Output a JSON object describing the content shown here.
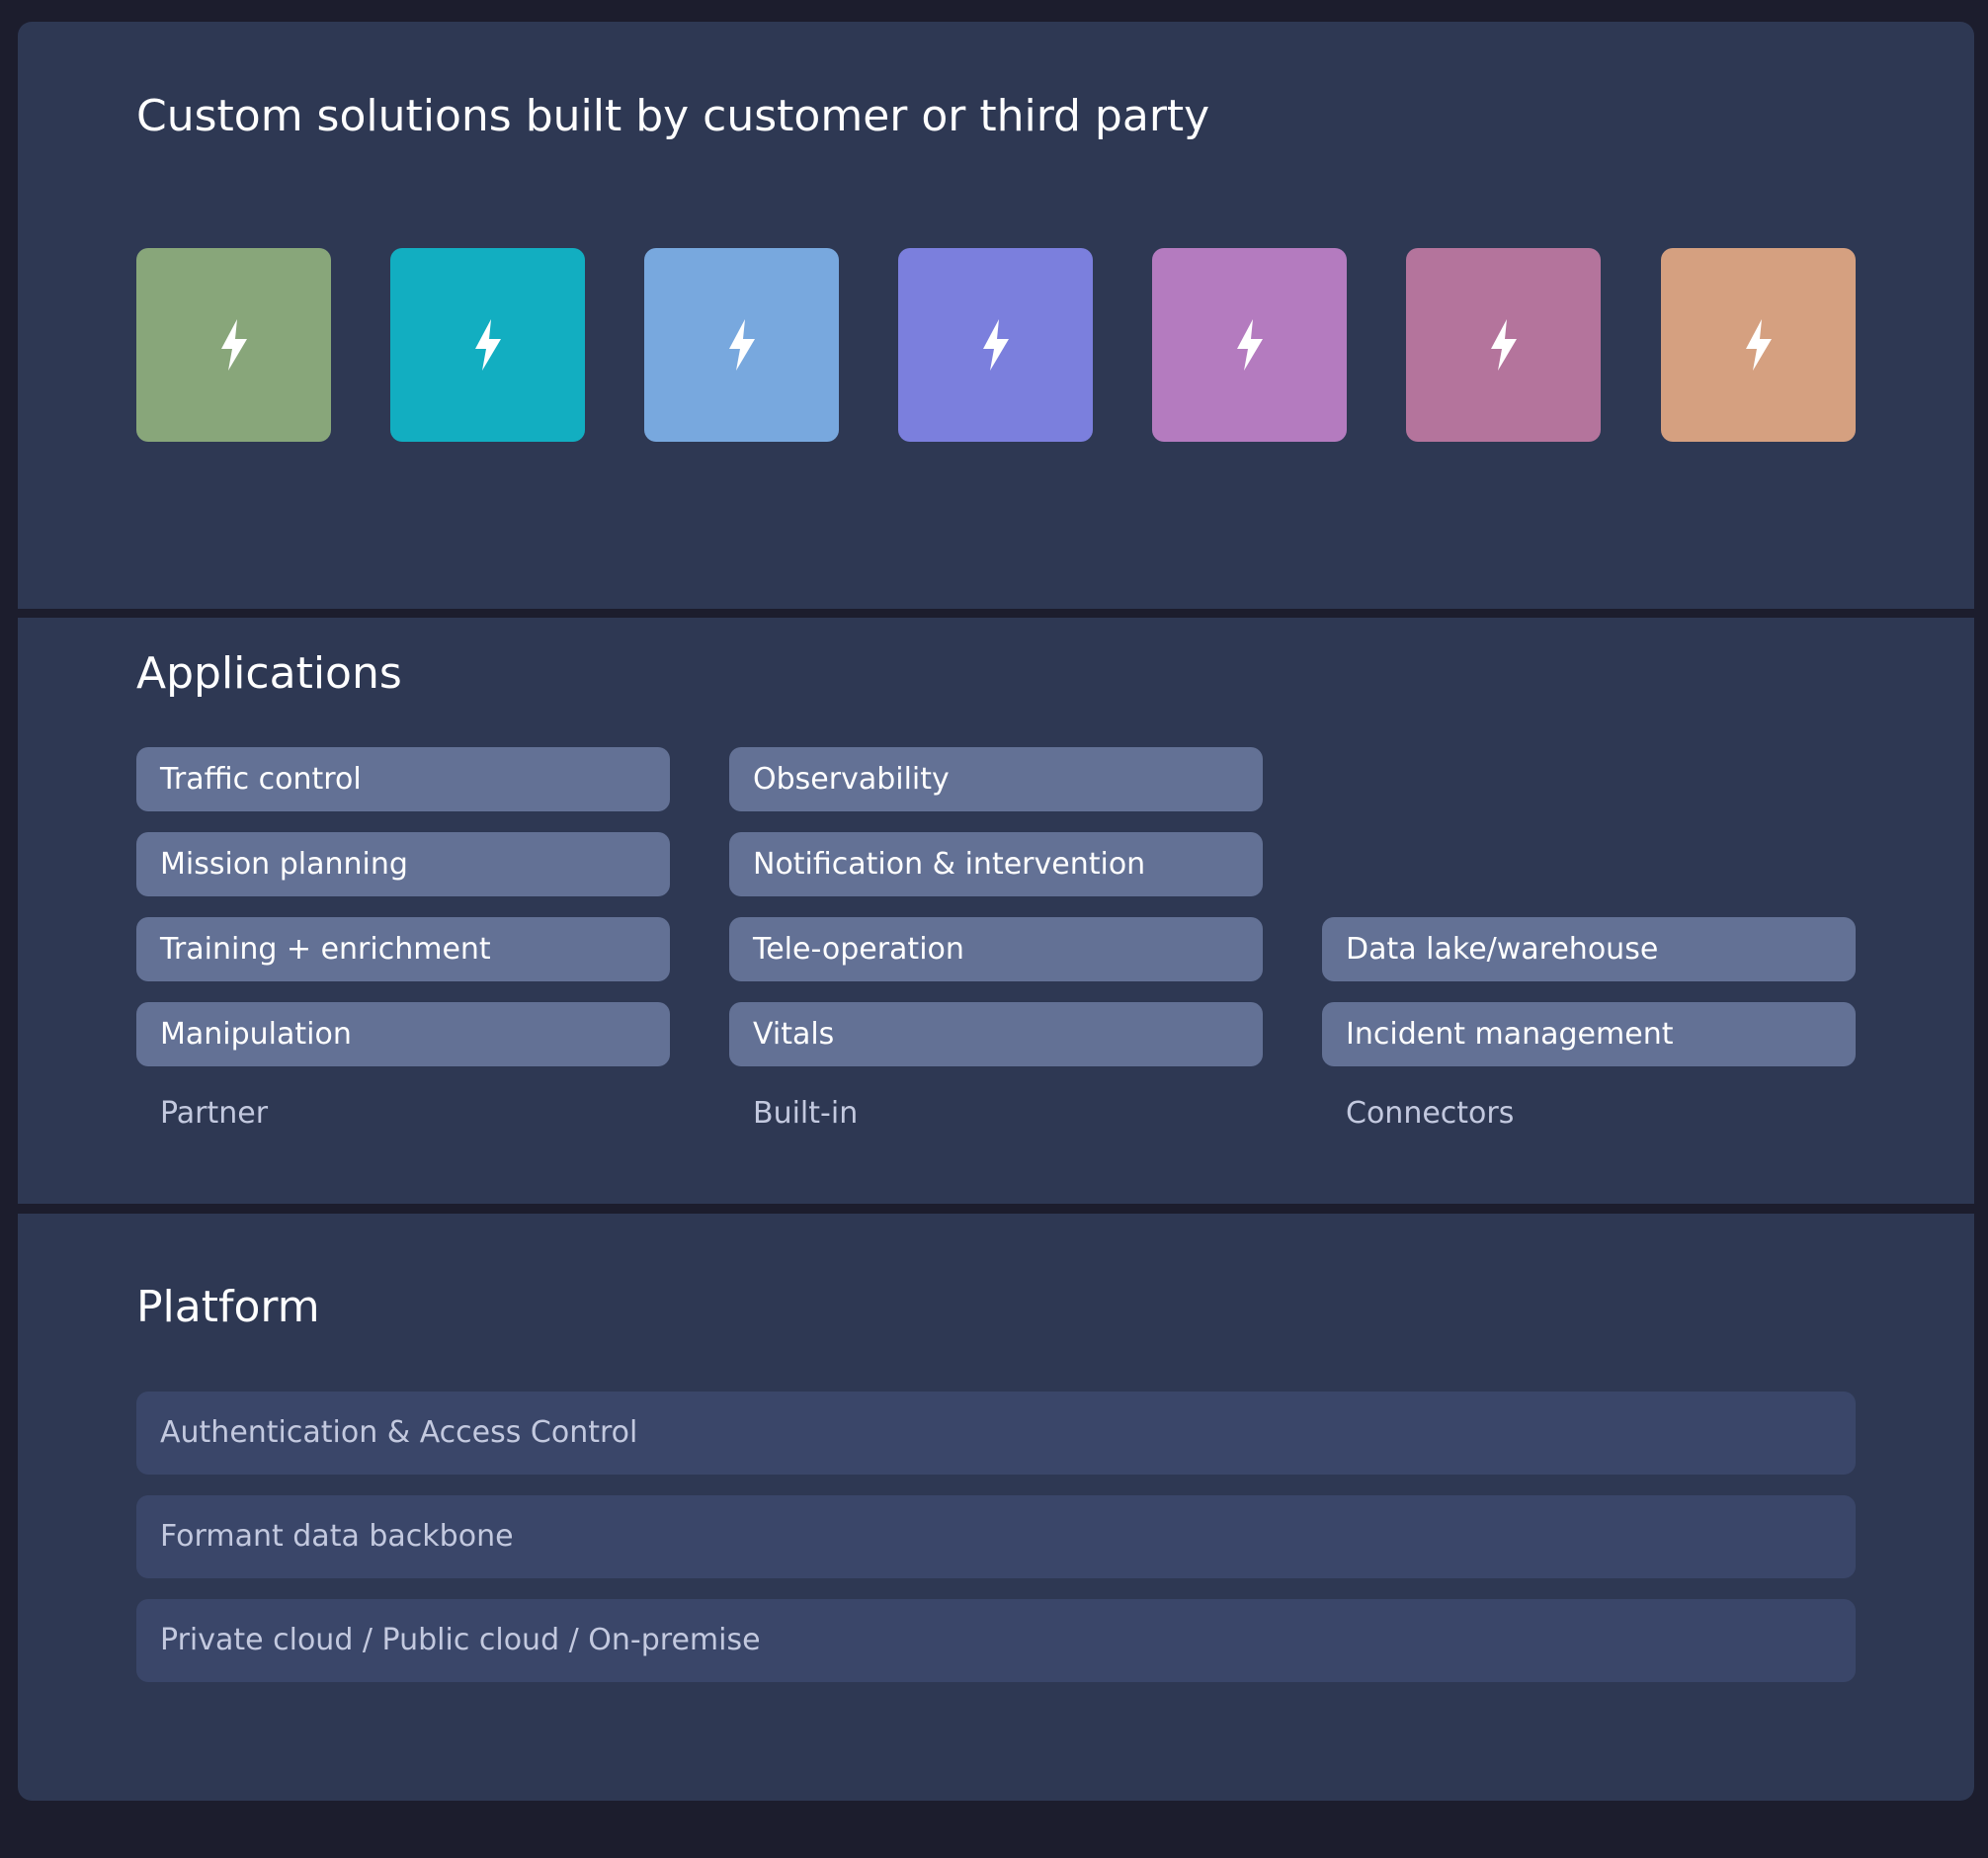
{
  "custom": {
    "title": "Custom solutions built by customer or third party",
    "tiles": [
      {
        "color": "#88a67a",
        "icon": "lightning-bolt-icon"
      },
      {
        "color": "#12aec1",
        "icon": "lightning-bolt-icon"
      },
      {
        "color": "#78a8de",
        "icon": "lightning-bolt-icon"
      },
      {
        "color": "#7b7fdd",
        "icon": "lightning-bolt-icon"
      },
      {
        "color": "#b47bbf",
        "icon": "lightning-bolt-icon"
      },
      {
        "color": "#b4749c",
        "icon": "lightning-bolt-icon"
      },
      {
        "color": "#d5a080",
        "icon": "lightning-bolt-icon"
      }
    ]
  },
  "applications": {
    "title": "Applications",
    "partner": {
      "label": "Partner",
      "items": [
        "Traffic control",
        "Mission planning",
        "Training + enrichment",
        "Manipulation"
      ]
    },
    "builtin": {
      "label": "Built-in",
      "items": [
        "Observability",
        "Notification & intervention",
        "Tele-operation",
        "Vitals"
      ]
    },
    "connectors": {
      "label": "Connectors",
      "items": [
        "Data lake/warehouse",
        "Incident management"
      ]
    }
  },
  "platform": {
    "title": "Platform",
    "layers": [
      "Authentication & Access Control",
      "Formant data backbone",
      "Private cloud / Public cloud / On-premise"
    ]
  },
  "colors": {
    "page_background": "#1c1d2d",
    "panel_background": "#2e3853",
    "application_pill": "#637195",
    "platform_bar": "#3a4669",
    "muted_text": "#c3c9df"
  }
}
